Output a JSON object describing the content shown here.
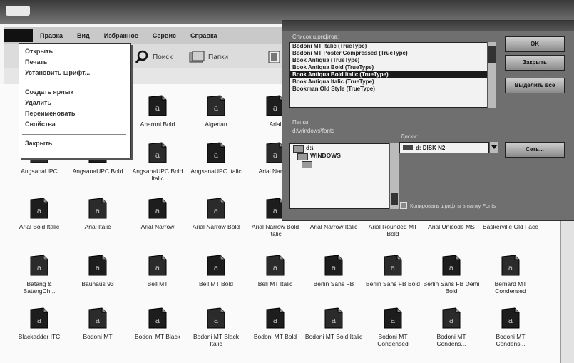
{
  "menubar": {
    "items": [
      {
        "label": ""
      },
      {
        "label": "Правка"
      },
      {
        "label": "Вид"
      },
      {
        "label": "Избранное"
      },
      {
        "label": "Сервис"
      },
      {
        "label": "Справка"
      }
    ]
  },
  "toolbar": {
    "search_label": "Поиск",
    "folders_label": "Папки"
  },
  "context_menu": {
    "items": [
      {
        "label": "Открыть"
      },
      {
        "label": "Печать"
      },
      {
        "label": "Установить шрифт..."
      },
      {
        "label": "Создать ярлык"
      },
      {
        "label": "Удалить"
      },
      {
        "label": "Переименовать"
      },
      {
        "label": "Свойства"
      },
      {
        "label": "Закрыть"
      }
    ]
  },
  "font_dialog": {
    "fonts_list_label": "Список шрифтов:",
    "fonts": [
      "Bodoni MT Italic (TrueType)",
      "Bodoni MT Poster Compressed (TrueType)",
      "Book Antiqua (TrueType)",
      "Book Antiqua Bold (TrueType)",
      "Book Antiqua Bold Italic (TrueType)",
      "Book Antiqua Italic (TrueType)",
      "Bookman Old Style (TrueType)"
    ],
    "selected_font_index": 4,
    "folders_label": "Папки:",
    "folders_path": "d:\\windows\\fonts",
    "folders": [
      {
        "label": "d:\\",
        "icon": "open-folder-icon"
      },
      {
        "label": "WINDOWS",
        "icon": "open-folder-icon"
      },
      {
        "label": "",
        "icon": "open-folder-icon"
      }
    ],
    "selected_folder_index": 2,
    "drives_label": "Диски:",
    "drive_value": "d: DISK N2",
    "buttons": {
      "ok": "OK",
      "close": "Закрыть",
      "select_all": "Выделить все",
      "network": "Сеть..."
    },
    "copy_checkbox_label": "Копировать шрифты в папку Fonts",
    "copy_checked": true
  },
  "files": [
    {
      "name": "Aharoni Bold"
    },
    {
      "name": "Algerian"
    },
    {
      "name": "Arial"
    },
    {
      "name": "AngsanaUPC"
    },
    {
      "name": "AngsanaUPC Bold"
    },
    {
      "name": "AngsanaUPC Bold Italic"
    },
    {
      "name": "AngsanaUPC Italic"
    },
    {
      "name": "Arial Narrow"
    },
    {
      "name": "Arial Bold Italic"
    },
    {
      "name": "Arial Italic"
    },
    {
      "name": "Arial Narrow"
    },
    {
      "name": "Arial Narrow Bold"
    },
    {
      "name": "Arial Narrow Bold Italic"
    },
    {
      "name": "Arial Narrow Italic"
    },
    {
      "name": "Arial Rounded MT Bold"
    },
    {
      "name": "Arial Unicode MS"
    },
    {
      "name": "Baskerville Old Face"
    },
    {
      "name": "Batang & BatangCh..."
    },
    {
      "name": "Bauhaus 93"
    },
    {
      "name": "Bell MT"
    },
    {
      "name": "Bell MT Bold"
    },
    {
      "name": "Bell MT Italic"
    },
    {
      "name": "Berlin Sans FB"
    },
    {
      "name": "Berlin Sans FB Bold"
    },
    {
      "name": "Berlin Sans FB Demi Bold"
    },
    {
      "name": "Bernard MT Condensed"
    },
    {
      "name": "Blackadder ITC"
    },
    {
      "name": "Bodoni MT"
    },
    {
      "name": "Bodoni MT Black"
    },
    {
      "name": "Bodoni MT Black Italic"
    },
    {
      "name": "Bodoni MT Bold"
    },
    {
      "name": "Bodoni MT Bold Italic"
    },
    {
      "name": "Bodoni MT Condensed"
    },
    {
      "name": "Bodoni MT Condens..."
    },
    {
      "name": "Bodoni MT Condens..."
    }
  ]
}
